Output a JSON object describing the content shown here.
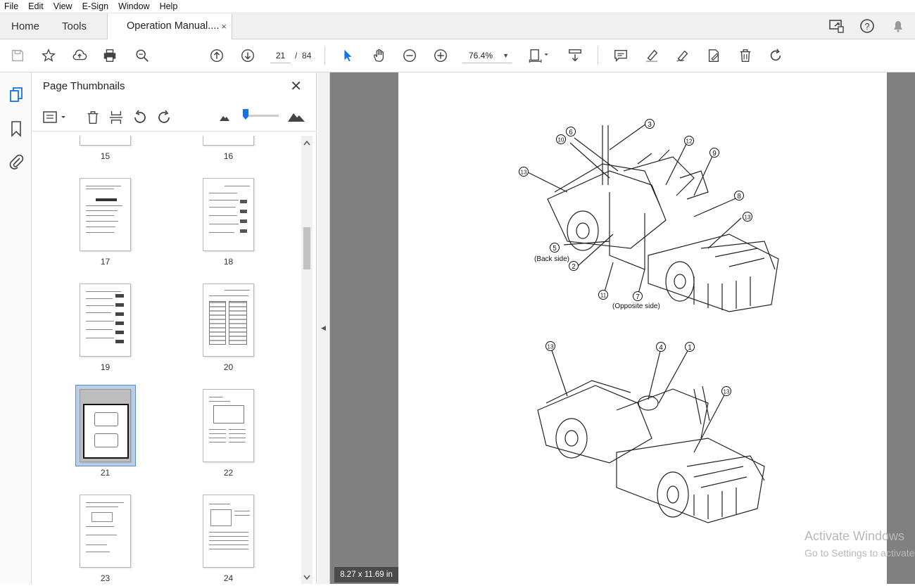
{
  "menu": [
    "File",
    "Edit",
    "View",
    "E-Sign",
    "Window",
    "Help"
  ],
  "tabs": {
    "home": "Home",
    "tools": "Tools",
    "document": "Operation Manual....",
    "close": "×"
  },
  "toolbar": {
    "current_page": "21",
    "page_sep": "/",
    "total_pages": "84",
    "zoom": "76.4%",
    "zoom_arrow": "▼"
  },
  "panel": {
    "title": "Page Thumbnails",
    "close": "✕"
  },
  "thumbnails": [
    {
      "label": "15"
    },
    {
      "label": "16"
    },
    {
      "label": "17"
    },
    {
      "label": "18"
    },
    {
      "label": "19"
    },
    {
      "label": "20"
    },
    {
      "label": "21",
      "selected": true
    },
    {
      "label": "22"
    },
    {
      "label": "23"
    },
    {
      "label": "24"
    }
  ],
  "figure": {
    "top_labels": [
      "3",
      "6",
      "10",
      "12",
      "9",
      "13",
      "8",
      "13",
      "5",
      "2",
      "11",
      "7"
    ],
    "back_side": "(Back side)",
    "opposite_side": "(Opposite side)",
    "bottom_labels": [
      "13",
      "4",
      "1",
      "13"
    ]
  },
  "status": {
    "page_size": "8.27 x 11.69 in"
  },
  "watermark": {
    "line1": "Activate Windows",
    "line2": "Go to Settings to activate Windows."
  },
  "colors": {
    "accent": "#1473e6",
    "viewer_bg": "#808080"
  }
}
